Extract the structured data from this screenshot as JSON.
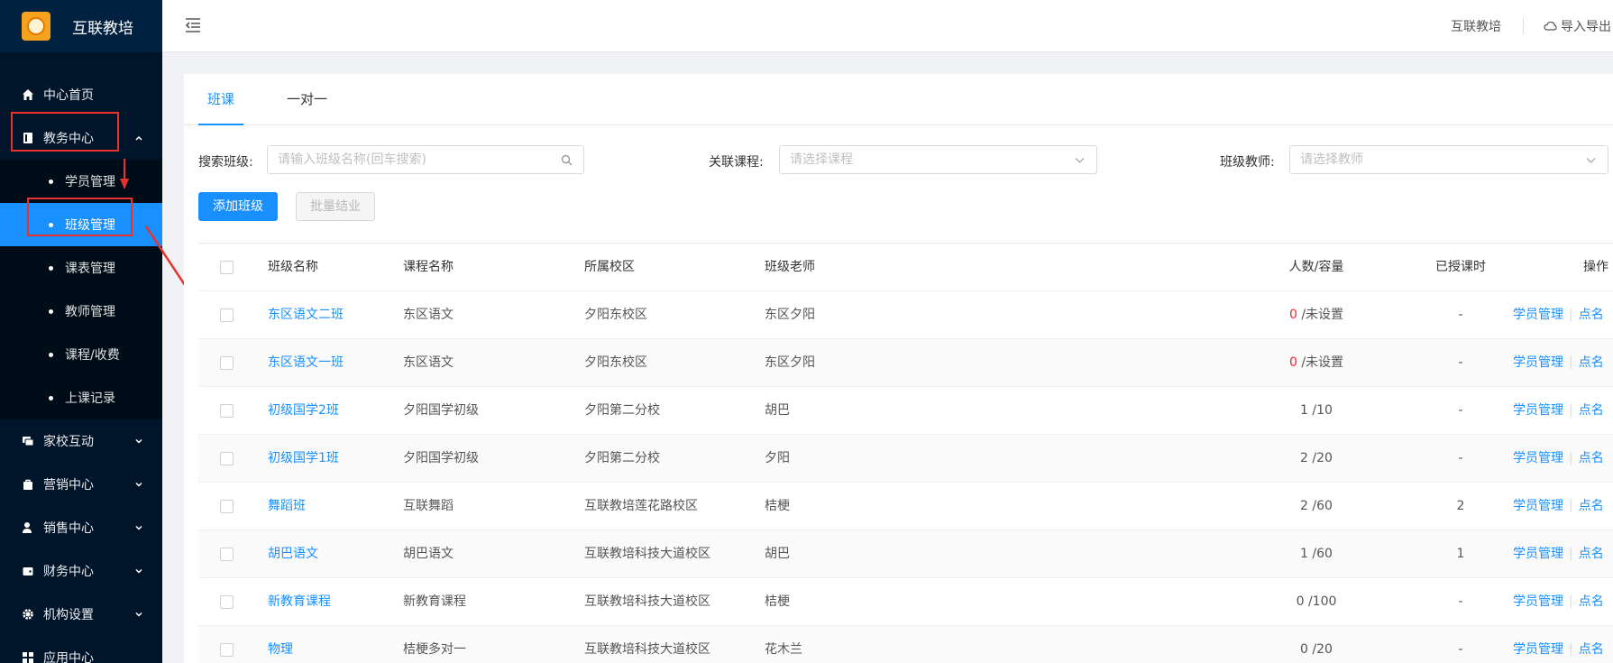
{
  "brand": {
    "title": "互联教培",
    "logo_icon": "school-logo-icon"
  },
  "sidebar": {
    "items": [
      {
        "label": "中心首页",
        "icon": "home-icon"
      },
      {
        "label": "教务中心",
        "icon": "book-icon",
        "expanded": true,
        "children": [
          "学员管理",
          "班级管理",
          "课表管理",
          "教师管理",
          "课程/收费",
          "上课记录"
        ],
        "active_child": "班级管理"
      },
      {
        "label": "家校互动",
        "icon": "chat-icon"
      },
      {
        "label": "营销中心",
        "icon": "bag-icon"
      },
      {
        "label": "销售中心",
        "icon": "user-edit-icon"
      },
      {
        "label": "财务中心",
        "icon": "wallet-icon"
      },
      {
        "label": "机构设置",
        "icon": "gear-icon"
      },
      {
        "label": "应用中心",
        "icon": "grid-icon"
      }
    ]
  },
  "header": {
    "user": "互联教培",
    "import_export": "导入导出"
  },
  "tabs": [
    "班课",
    "一对一"
  ],
  "filters": {
    "search_label": "搜索班级:",
    "search_placeholder": "请输入班级名称(回车搜索)",
    "course_label": "关联课程:",
    "course_placeholder": "请选择课程",
    "teacher_label": "班级教师:",
    "teacher_placeholder": "请选择教师"
  },
  "buttons": {
    "add": "添加班级",
    "batch": "批量结业"
  },
  "table": {
    "headers": [
      "班级名称",
      "课程名称",
      "所属校区",
      "班级老师",
      "人数/容量",
      "已授课时",
      "操作"
    ],
    "rows": [
      {
        "name": "东区语文二班",
        "course": "东区语文",
        "campus": "夕阳东校区",
        "teacher": "东区夕阳",
        "count": "0",
        "capacity": "/未设置",
        "hours": "-"
      },
      {
        "name": "东区语文一班",
        "course": "东区语文",
        "campus": "夕阳东校区",
        "teacher": "东区夕阳",
        "count": "0",
        "capacity": "/未设置",
        "hours": "-"
      },
      {
        "name": "初级国学2班",
        "course": "夕阳国学初级",
        "campus": "夕阳第二分校",
        "teacher": "胡巴",
        "count": "1",
        "capacity": "/10",
        "hours": "-"
      },
      {
        "name": "初级国学1班",
        "course": "夕阳国学初级",
        "campus": "夕阳第二分校",
        "teacher": "夕阳",
        "count": "2",
        "capacity": "/20",
        "hours": "-"
      },
      {
        "name": "舞蹈班",
        "course": "互联舞蹈",
        "campus": "互联教培莲花路校区",
        "teacher": "桔梗",
        "count": "2",
        "capacity": "/60",
        "hours": "2"
      },
      {
        "name": "胡巴语文",
        "course": "胡巴语文",
        "campus": "互联教培科技大道校区",
        "teacher": "胡巴",
        "count": "1",
        "capacity": "/60",
        "hours": "1"
      },
      {
        "name": "新教育课程",
        "course": "新教育课程",
        "campus": "互联教培科技大道校区",
        "teacher": "桔梗",
        "count": "0",
        "capacity": "/100",
        "hours": "-"
      },
      {
        "name": "物理",
        "course": "桔梗多对一",
        "campus": "互联教培科技大道校区",
        "teacher": "花木兰",
        "count": "0",
        "capacity": "/20",
        "hours": "-"
      }
    ],
    "op_students": "学员管理",
    "op_rollcall": "点名"
  },
  "colors": {
    "sidebar_bg": "#001529",
    "accent": "#1890ff",
    "highlight_box": "#e8332d",
    "zero_count": "#f5222d"
  }
}
